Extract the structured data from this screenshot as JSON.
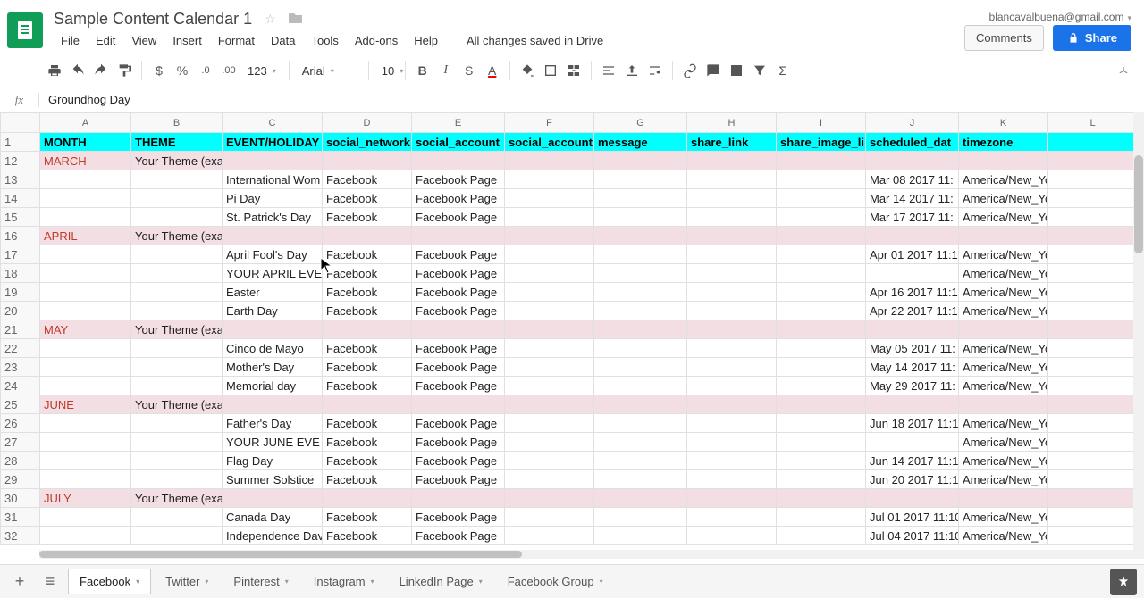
{
  "doc": {
    "title": "Sample Content Calendar 1",
    "status": "All changes saved in Drive",
    "user_email": "blancavalbuena@gmail.com"
  },
  "menu": {
    "file": "File",
    "edit": "Edit",
    "view": "View",
    "insert": "Insert",
    "format": "Format",
    "data": "Data",
    "tools": "Tools",
    "addons": "Add-ons",
    "help": "Help"
  },
  "header_buttons": {
    "comments": "Comments",
    "share": "Share"
  },
  "toolbar": {
    "zoom": "123",
    "font": "Arial",
    "font_size": "10",
    "currency": "$",
    "percent": "%",
    "dec_dec": ".0",
    "dec_inc": ".00"
  },
  "formula": {
    "value": "Groundhog Day"
  },
  "columns": [
    "A",
    "B",
    "C",
    "D",
    "E",
    "F",
    "G",
    "H",
    "I",
    "J",
    "K",
    "L"
  ],
  "headers": {
    "A": "MONTH",
    "B": "THEME",
    "C": "EVENT/HOLIDAY",
    "D": "social_network",
    "E": "social_account",
    "F": "social_account",
    "G": "message",
    "H": "share_link",
    "I": "share_image_li",
    "J": "scheduled_dat",
    "K": "timezone",
    "L": ""
  },
  "rows": [
    {
      "n": 12,
      "type": "month",
      "A": "MARCH",
      "B": "Your Theme (example Weight Loss)"
    },
    {
      "n": 13,
      "type": "data",
      "C": "International Wom",
      "D": "Facebook",
      "E": "Facebook Page",
      "J": "Mar 08 2017 11:",
      "K": "America/New_York"
    },
    {
      "n": 14,
      "type": "data",
      "C": "Pi Day",
      "D": "Facebook",
      "E": "Facebook Page",
      "J": "Mar 14 2017 11:",
      "K": "America/New_York"
    },
    {
      "n": 15,
      "type": "data",
      "C": "St. Patrick's Day",
      "D": "Facebook",
      "E": "Facebook Page",
      "J": "Mar 17 2017 11:",
      "K": "America/New_York"
    },
    {
      "n": 16,
      "type": "month",
      "A": "APRIL",
      "B": "Your Theme (example Weight Loss)"
    },
    {
      "n": 17,
      "type": "data",
      "C": "April Fool's Day",
      "D": "Facebook",
      "E": "Facebook Page",
      "J": "Apr 01 2017 11:1",
      "K": "America/New_York"
    },
    {
      "n": 18,
      "type": "data",
      "C": "YOUR APRIL EVE",
      "D": "Facebook",
      "E": "Facebook Page",
      "J": "",
      "K": "America/New_York"
    },
    {
      "n": 19,
      "type": "data",
      "C": "Easter",
      "D": "Facebook",
      "E": "Facebook Page",
      "J": "Apr 16 2017 11:1",
      "K": "America/New_York"
    },
    {
      "n": 20,
      "type": "data",
      "C": "Earth Day",
      "D": "Facebook",
      "E": "Facebook Page",
      "J": "Apr 22 2017 11:1",
      "K": "America/New_York"
    },
    {
      "n": 21,
      "type": "month",
      "A": "MAY",
      "B": "Your Theme (example Weight Loss)"
    },
    {
      "n": 22,
      "type": "data",
      "C": "Cinco de Mayo",
      "D": "Facebook",
      "E": "Facebook Page",
      "J": "May 05 2017 11:",
      "K": "America/New_York"
    },
    {
      "n": 23,
      "type": "data",
      "C": "Mother's Day",
      "D": "Facebook",
      "E": "Facebook Page",
      "J": "May 14 2017 11:",
      "K": "America/New_York"
    },
    {
      "n": 24,
      "type": "data",
      "C": "Memorial day",
      "D": "Facebook",
      "E": "Facebook Page",
      "J": "May 29 2017 11:",
      "K": "America/New_York"
    },
    {
      "n": 25,
      "type": "month",
      "A": "JUNE",
      "B": "Your Theme (example Weight Loss)"
    },
    {
      "n": 26,
      "type": "data",
      "C": "Father's Day",
      "D": "Facebook",
      "E": "Facebook Page",
      "J": "Jun 18 2017 11:1",
      "K": "America/New_York"
    },
    {
      "n": 27,
      "type": "data",
      "C": "YOUR JUNE EVE",
      "D": "Facebook",
      "E": "Facebook Page",
      "J": "",
      "K": "America/New_York"
    },
    {
      "n": 28,
      "type": "data",
      "C": "Flag Day",
      "D": "Facebook",
      "E": "Facebook Page",
      "J": "Jun 14 2017 11:1",
      "K": "America/New_York"
    },
    {
      "n": 29,
      "type": "data",
      "C": "Summer Solstice",
      "D": "Facebook",
      "E": "Facebook Page",
      "J": "Jun 20 2017 11:1",
      "K": "America/New_York"
    },
    {
      "n": 30,
      "type": "month",
      "A": "JULY",
      "B": "Your Theme (example Weight Loss)"
    },
    {
      "n": 31,
      "type": "data",
      "C": "Canada Day",
      "D": "Facebook",
      "E": "Facebook Page",
      "J": "Jul 01 2017 11:10",
      "K": "America/New_York"
    },
    {
      "n": 32,
      "type": "data",
      "C": "Independence Dav",
      "D": "Facebook",
      "E": "Facebook Page",
      "J": "Jul 04 2017 11:10",
      "K": "America/New_York"
    }
  ],
  "sheets": [
    {
      "label": "Facebook",
      "active": true
    },
    {
      "label": "Twitter"
    },
    {
      "label": "Pinterest"
    },
    {
      "label": "Instagram"
    },
    {
      "label": "LinkedIn Page"
    },
    {
      "label": "Facebook Group"
    }
  ]
}
